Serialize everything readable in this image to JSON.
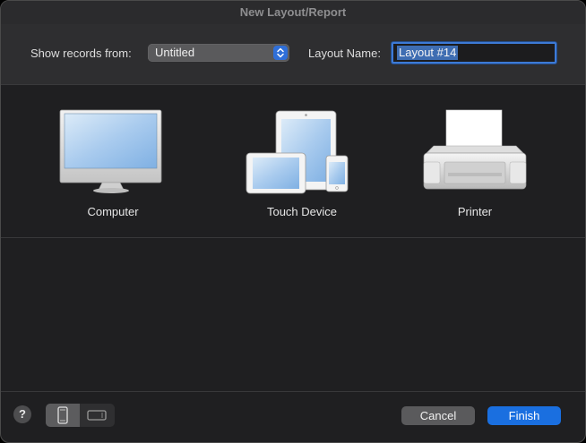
{
  "window": {
    "title": "New Layout/Report"
  },
  "toolbar": {
    "show_records_label": "Show records from:",
    "show_records_value": "Untitled",
    "layout_name_label": "Layout Name:",
    "layout_name_value": "Layout #14"
  },
  "devices": [
    {
      "name": "Computer",
      "icon": "computer-icon"
    },
    {
      "name": "Touch Device",
      "icon": "touch-device-icon"
    },
    {
      "name": "Printer",
      "icon": "printer-icon"
    }
  ],
  "footer": {
    "help_label": "?",
    "cancel_label": "Cancel",
    "finish_label": "Finish"
  },
  "colors": {
    "accent": "#1a6fe0",
    "background": "#1f1f21"
  }
}
